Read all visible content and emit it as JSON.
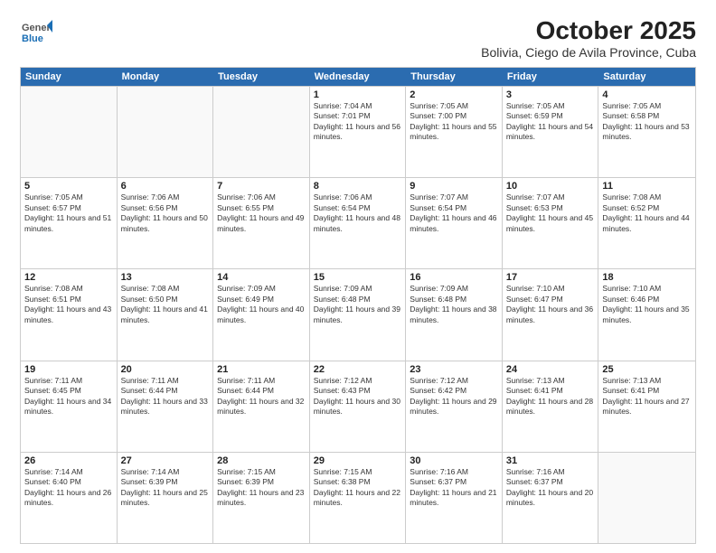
{
  "logo": {
    "general": "General",
    "blue": "Blue"
  },
  "title": "October 2025",
  "subtitle": "Bolivia, Ciego de Avila Province, Cuba",
  "header_days": [
    "Sunday",
    "Monday",
    "Tuesday",
    "Wednesday",
    "Thursday",
    "Friday",
    "Saturday"
  ],
  "weeks": [
    [
      {
        "day": "",
        "sunrise": "",
        "sunset": "",
        "daylight": "",
        "empty": true
      },
      {
        "day": "",
        "sunrise": "",
        "sunset": "",
        "daylight": "",
        "empty": true
      },
      {
        "day": "",
        "sunrise": "",
        "sunset": "",
        "daylight": "",
        "empty": true
      },
      {
        "day": "1",
        "sunrise": "Sunrise: 7:04 AM",
        "sunset": "Sunset: 7:01 PM",
        "daylight": "Daylight: 11 hours and 56 minutes."
      },
      {
        "day": "2",
        "sunrise": "Sunrise: 7:05 AM",
        "sunset": "Sunset: 7:00 PM",
        "daylight": "Daylight: 11 hours and 55 minutes."
      },
      {
        "day": "3",
        "sunrise": "Sunrise: 7:05 AM",
        "sunset": "Sunset: 6:59 PM",
        "daylight": "Daylight: 11 hours and 54 minutes."
      },
      {
        "day": "4",
        "sunrise": "Sunrise: 7:05 AM",
        "sunset": "Sunset: 6:58 PM",
        "daylight": "Daylight: 11 hours and 53 minutes."
      }
    ],
    [
      {
        "day": "5",
        "sunrise": "Sunrise: 7:05 AM",
        "sunset": "Sunset: 6:57 PM",
        "daylight": "Daylight: 11 hours and 51 minutes."
      },
      {
        "day": "6",
        "sunrise": "Sunrise: 7:06 AM",
        "sunset": "Sunset: 6:56 PM",
        "daylight": "Daylight: 11 hours and 50 minutes."
      },
      {
        "day": "7",
        "sunrise": "Sunrise: 7:06 AM",
        "sunset": "Sunset: 6:55 PM",
        "daylight": "Daylight: 11 hours and 49 minutes."
      },
      {
        "day": "8",
        "sunrise": "Sunrise: 7:06 AM",
        "sunset": "Sunset: 6:54 PM",
        "daylight": "Daylight: 11 hours and 48 minutes."
      },
      {
        "day": "9",
        "sunrise": "Sunrise: 7:07 AM",
        "sunset": "Sunset: 6:54 PM",
        "daylight": "Daylight: 11 hours and 46 minutes."
      },
      {
        "day": "10",
        "sunrise": "Sunrise: 7:07 AM",
        "sunset": "Sunset: 6:53 PM",
        "daylight": "Daylight: 11 hours and 45 minutes."
      },
      {
        "day": "11",
        "sunrise": "Sunrise: 7:08 AM",
        "sunset": "Sunset: 6:52 PM",
        "daylight": "Daylight: 11 hours and 44 minutes."
      }
    ],
    [
      {
        "day": "12",
        "sunrise": "Sunrise: 7:08 AM",
        "sunset": "Sunset: 6:51 PM",
        "daylight": "Daylight: 11 hours and 43 minutes."
      },
      {
        "day": "13",
        "sunrise": "Sunrise: 7:08 AM",
        "sunset": "Sunset: 6:50 PM",
        "daylight": "Daylight: 11 hours and 41 minutes."
      },
      {
        "day": "14",
        "sunrise": "Sunrise: 7:09 AM",
        "sunset": "Sunset: 6:49 PM",
        "daylight": "Daylight: 11 hours and 40 minutes."
      },
      {
        "day": "15",
        "sunrise": "Sunrise: 7:09 AM",
        "sunset": "Sunset: 6:48 PM",
        "daylight": "Daylight: 11 hours and 39 minutes."
      },
      {
        "day": "16",
        "sunrise": "Sunrise: 7:09 AM",
        "sunset": "Sunset: 6:48 PM",
        "daylight": "Daylight: 11 hours and 38 minutes."
      },
      {
        "day": "17",
        "sunrise": "Sunrise: 7:10 AM",
        "sunset": "Sunset: 6:47 PM",
        "daylight": "Daylight: 11 hours and 36 minutes."
      },
      {
        "day": "18",
        "sunrise": "Sunrise: 7:10 AM",
        "sunset": "Sunset: 6:46 PM",
        "daylight": "Daylight: 11 hours and 35 minutes."
      }
    ],
    [
      {
        "day": "19",
        "sunrise": "Sunrise: 7:11 AM",
        "sunset": "Sunset: 6:45 PM",
        "daylight": "Daylight: 11 hours and 34 minutes."
      },
      {
        "day": "20",
        "sunrise": "Sunrise: 7:11 AM",
        "sunset": "Sunset: 6:44 PM",
        "daylight": "Daylight: 11 hours and 33 minutes."
      },
      {
        "day": "21",
        "sunrise": "Sunrise: 7:11 AM",
        "sunset": "Sunset: 6:44 PM",
        "daylight": "Daylight: 11 hours and 32 minutes."
      },
      {
        "day": "22",
        "sunrise": "Sunrise: 7:12 AM",
        "sunset": "Sunset: 6:43 PM",
        "daylight": "Daylight: 11 hours and 30 minutes."
      },
      {
        "day": "23",
        "sunrise": "Sunrise: 7:12 AM",
        "sunset": "Sunset: 6:42 PM",
        "daylight": "Daylight: 11 hours and 29 minutes."
      },
      {
        "day": "24",
        "sunrise": "Sunrise: 7:13 AM",
        "sunset": "Sunset: 6:41 PM",
        "daylight": "Daylight: 11 hours and 28 minutes."
      },
      {
        "day": "25",
        "sunrise": "Sunrise: 7:13 AM",
        "sunset": "Sunset: 6:41 PM",
        "daylight": "Daylight: 11 hours and 27 minutes."
      }
    ],
    [
      {
        "day": "26",
        "sunrise": "Sunrise: 7:14 AM",
        "sunset": "Sunset: 6:40 PM",
        "daylight": "Daylight: 11 hours and 26 minutes."
      },
      {
        "day": "27",
        "sunrise": "Sunrise: 7:14 AM",
        "sunset": "Sunset: 6:39 PM",
        "daylight": "Daylight: 11 hours and 25 minutes."
      },
      {
        "day": "28",
        "sunrise": "Sunrise: 7:15 AM",
        "sunset": "Sunset: 6:39 PM",
        "daylight": "Daylight: 11 hours and 23 minutes."
      },
      {
        "day": "29",
        "sunrise": "Sunrise: 7:15 AM",
        "sunset": "Sunset: 6:38 PM",
        "daylight": "Daylight: 11 hours and 22 minutes."
      },
      {
        "day": "30",
        "sunrise": "Sunrise: 7:16 AM",
        "sunset": "Sunset: 6:37 PM",
        "daylight": "Daylight: 11 hours and 21 minutes."
      },
      {
        "day": "31",
        "sunrise": "Sunrise: 7:16 AM",
        "sunset": "Sunset: 6:37 PM",
        "daylight": "Daylight: 11 hours and 20 minutes."
      },
      {
        "day": "",
        "sunrise": "",
        "sunset": "",
        "daylight": "",
        "empty": true
      }
    ]
  ]
}
